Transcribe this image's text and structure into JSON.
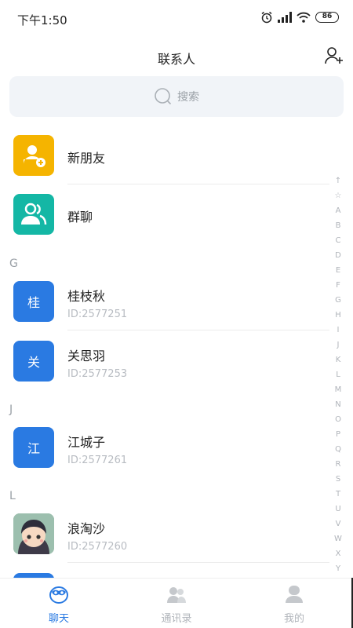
{
  "status": {
    "time": "下午1:50",
    "battery": "86"
  },
  "header": {
    "title": "联系人"
  },
  "search": {
    "placeholder": "搜索"
  },
  "special": [
    {
      "name": "新朋友",
      "icon": "new-friend-icon",
      "color": "#f5b400"
    },
    {
      "name": "群聊",
      "icon": "group-chat-icon",
      "color": "#14b7a5"
    }
  ],
  "sections": [
    {
      "letter": "G"
    },
    {
      "letter": "J"
    },
    {
      "letter": "L"
    }
  ],
  "contacts": [
    {
      "initial": "桂",
      "name": "桂枝秋",
      "id_text": "ID:2577251"
    },
    {
      "initial": "关",
      "name": "关思羽",
      "id_text": "ID:2577253"
    },
    {
      "initial": "江",
      "name": "江城子",
      "id_text": "ID:2577261"
    },
    {
      "initial": "",
      "name": "浪淘沙",
      "id_text": "ID:2577260"
    }
  ],
  "index_letters": [
    "↑",
    "☆",
    "A",
    "B",
    "C",
    "D",
    "E",
    "F",
    "G",
    "H",
    "I",
    "J",
    "K",
    "L",
    "M",
    "N",
    "O",
    "P",
    "Q",
    "R",
    "S",
    "T",
    "U",
    "V",
    "W",
    "X",
    "Y"
  ],
  "tabs": [
    {
      "label": "聊天",
      "icon": "chat-icon",
      "active": true
    },
    {
      "label": "通讯录",
      "icon": "contacts-icon",
      "active": false
    },
    {
      "label": "我的",
      "icon": "profile-icon",
      "active": false
    }
  ],
  "colors": {
    "accent": "#2a7ae2",
    "new_friend": "#f5b400",
    "group": "#14b7a5"
  }
}
